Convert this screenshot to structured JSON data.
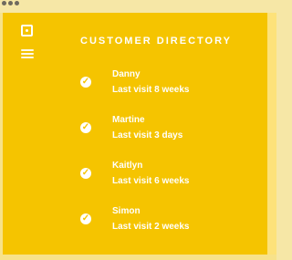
{
  "window": {
    "controls": [
      "dot-icon",
      "dot-icon",
      "dot-icon"
    ]
  },
  "sidebar": {
    "icons": [
      "square-icon",
      "menu-icon"
    ]
  },
  "main": {
    "title": "CUSTOMER DIRECTORY",
    "customers": [
      {
        "name": "Danny",
        "last_visit": "Last visit 8 weeks"
      },
      {
        "name": "Martine",
        "last_visit": "Last visit 3 days"
      },
      {
        "name": "Kaitlyn",
        "last_visit": "Last visit 6 weeks"
      },
      {
        "name": "Simon",
        "last_visit": "Last visit 2 weeks"
      }
    ]
  },
  "colors": {
    "background": "#f5c400",
    "text": "#ffffff",
    "frame": "#f6e7a6"
  }
}
